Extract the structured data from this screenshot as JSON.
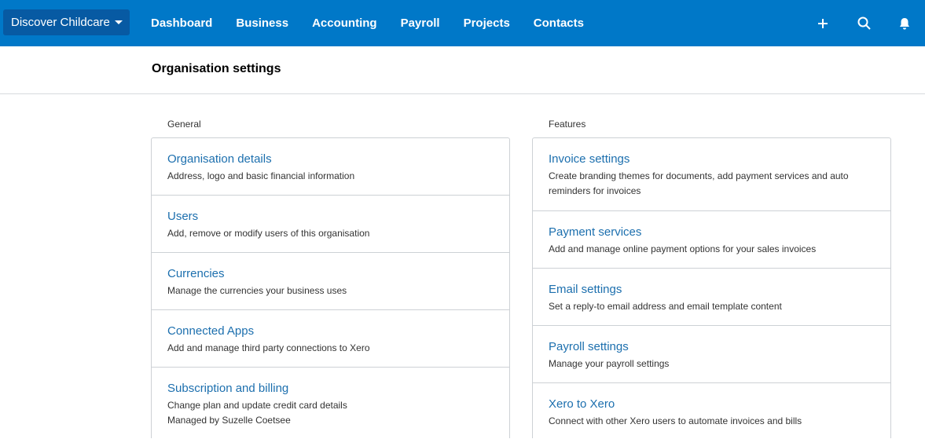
{
  "topbar": {
    "org_name": "Discover Childcare",
    "nav": [
      "Dashboard",
      "Business",
      "Accounting",
      "Payroll",
      "Projects",
      "Contacts"
    ],
    "tools": [
      "plus-icon",
      "search-icon",
      "bell-icon"
    ]
  },
  "page": {
    "title": "Organisation settings"
  },
  "general": {
    "title": "General",
    "items": [
      {
        "title": "Organisation details",
        "desc": "Address, logo and basic financial information"
      },
      {
        "title": "Users",
        "desc": "Add, remove or modify users of this organisation"
      },
      {
        "title": "Currencies",
        "desc": "Manage the currencies your business uses"
      },
      {
        "title": "Connected Apps",
        "desc": "Add and manage third party connections to Xero"
      },
      {
        "title": "Subscription and billing",
        "desc": "Change plan and update credit card details",
        "desc2": "Managed by Suzelle Coetsee"
      }
    ]
  },
  "features": {
    "title": "Features",
    "items": [
      {
        "title": "Invoice settings",
        "desc": "Create branding themes for documents, add payment services and auto reminders for invoices"
      },
      {
        "title": "Payment services",
        "desc": "Add and manage online payment options for your sales invoices"
      },
      {
        "title": "Email settings",
        "desc": "Set a reply-to email address and email template content"
      },
      {
        "title": "Payroll settings",
        "desc": "Manage your payroll settings"
      },
      {
        "title": "Xero to Xero",
        "desc": "Connect with other Xero users to automate invoices and bills"
      }
    ]
  },
  "colors": {
    "topbar": "#0078c8",
    "org_switch": "#075aa3",
    "link": "#1c6fae"
  }
}
